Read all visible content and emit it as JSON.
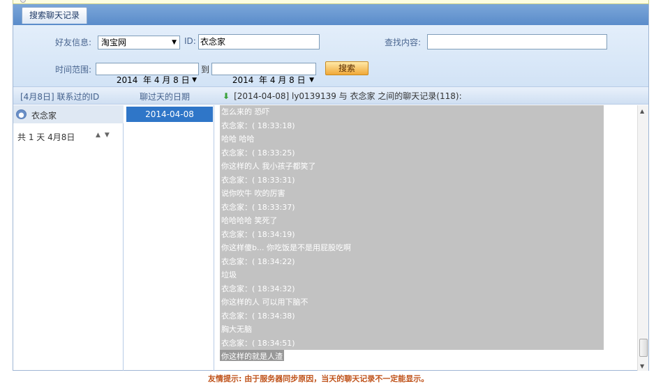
{
  "tab_label": "搜索聊天记录",
  "filters": {
    "friend_info_label": "好友信息:",
    "friend_source_value": "淘宝网",
    "id_label": "ID:",
    "id_value": "衣念家",
    "content_label": "查找内容:",
    "content_value": "",
    "time_range_label": "时间范围:",
    "start_date": "2014  年 4 月 8 日",
    "to_label": "到",
    "end_date": "2014  年 4 月 8 日",
    "search_button": "搜索"
  },
  "header": {
    "contacts_heading": "[4月8日] 联系过的ID",
    "dates_heading": "聊过天的日期",
    "history_title": "[2014-04-08] ly0139139 与 衣念家 之间的聊天记录(118):"
  },
  "contacts": {
    "friend_name": "衣念家",
    "days_summary": "共 1 天  4月8日"
  },
  "dates": {
    "selected_date": "2014-04-08"
  },
  "chat": {
    "lines": [
      "怎么来的  恐吓",
      "衣念家：( 18:33:18)",
      "哈哈  哈哈",
      "衣念家：( 18:33:25)",
      "你这样的人  我小孩子都笑了",
      "衣念家：( 18:33:31)",
      "说你吹牛  吹的厉害",
      "衣念家：( 18:33:37)",
      "哈哈哈哈  笑死了",
      "衣念家：( 18:34:19)",
      "你这样傻b... 你吃饭是不是用屁股吃啊",
      "衣念家：( 18:34:22)",
      "垃圾",
      "衣念家：( 18:34:32)",
      "你这样的人  可以用下脑不",
      "衣念家：( 18:34:38)",
      "胸大无脑",
      "衣念家：( 18:34:51)",
      "你这样的就是人渣"
    ]
  },
  "footer_tip": "友情提示: 由于服务器同步原因，当天的聊天记录不一定能显示。"
}
